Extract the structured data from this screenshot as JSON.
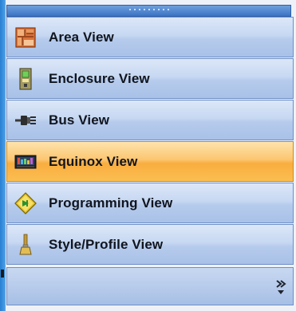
{
  "nav": {
    "items": [
      {
        "label": "Area View",
        "icon": "area-map-icon",
        "active": false
      },
      {
        "label": "Enclosure View",
        "icon": "enclosure-icon",
        "active": false
      },
      {
        "label": "Bus View",
        "icon": "bus-cable-icon",
        "active": false
      },
      {
        "label": "Equinox View",
        "icon": "equinox-device-icon",
        "active": true
      },
      {
        "label": "Programming View",
        "icon": "programming-diamond-icon",
        "active": false
      },
      {
        "label": "Style/Profile View",
        "icon": "style-brush-icon",
        "active": false
      }
    ]
  },
  "overflow": {
    "icon": "chevron-double-down-icon"
  },
  "colors": {
    "item_bg": "#c7d8f2",
    "item_active_bg": "#fcc670",
    "splitter": "#3c74c4",
    "text": "#10151e"
  }
}
